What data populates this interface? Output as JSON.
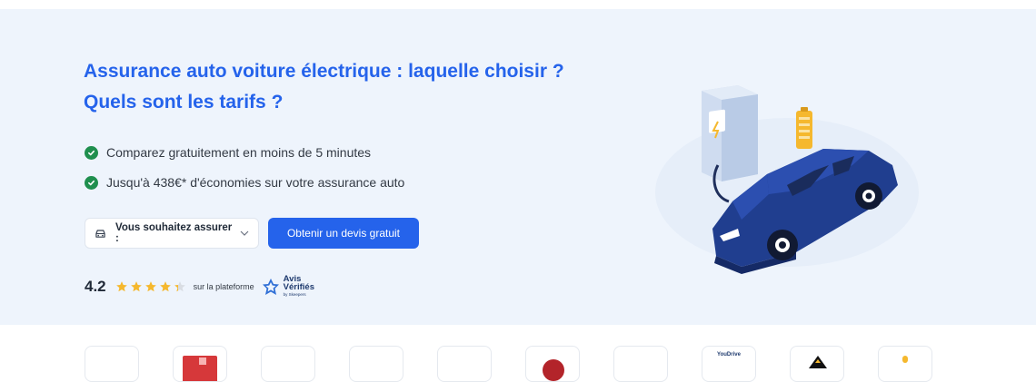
{
  "hero": {
    "title_line1": "Assurance auto voiture électrique : laquelle choisir ?",
    "title_line2": "Quels sont les tarifs ?",
    "bullets": [
      "Comparez gratuitement en moins de 5 minutes",
      "Jusqu'à 438€* d'économies sur votre assurance auto"
    ],
    "select_label": "Vous souhaitez assurer :",
    "cta_label": "Obtenir un devis gratuit",
    "rating": {
      "score": "4.2",
      "stars": 4.2,
      "max_stars": 5,
      "platform_text": "sur la plateforme",
      "logo_line1": "Avis",
      "logo_line2": "Vérifiés",
      "logo_line3": "by Skeepers"
    }
  },
  "partners": {
    "logo_texts": [
      "",
      "",
      "",
      "",
      "",
      "",
      "",
      "YouDrive",
      "",
      ""
    ]
  },
  "colors": {
    "accent": "#2563eb",
    "hero_bg": "#eef4fc",
    "check": "#1f8f4e",
    "star": "#f5b82e"
  },
  "icons": [
    "check-circle-icon",
    "car-icon",
    "chevron-down-icon",
    "star-icon",
    "avis-verifies-logo"
  ]
}
